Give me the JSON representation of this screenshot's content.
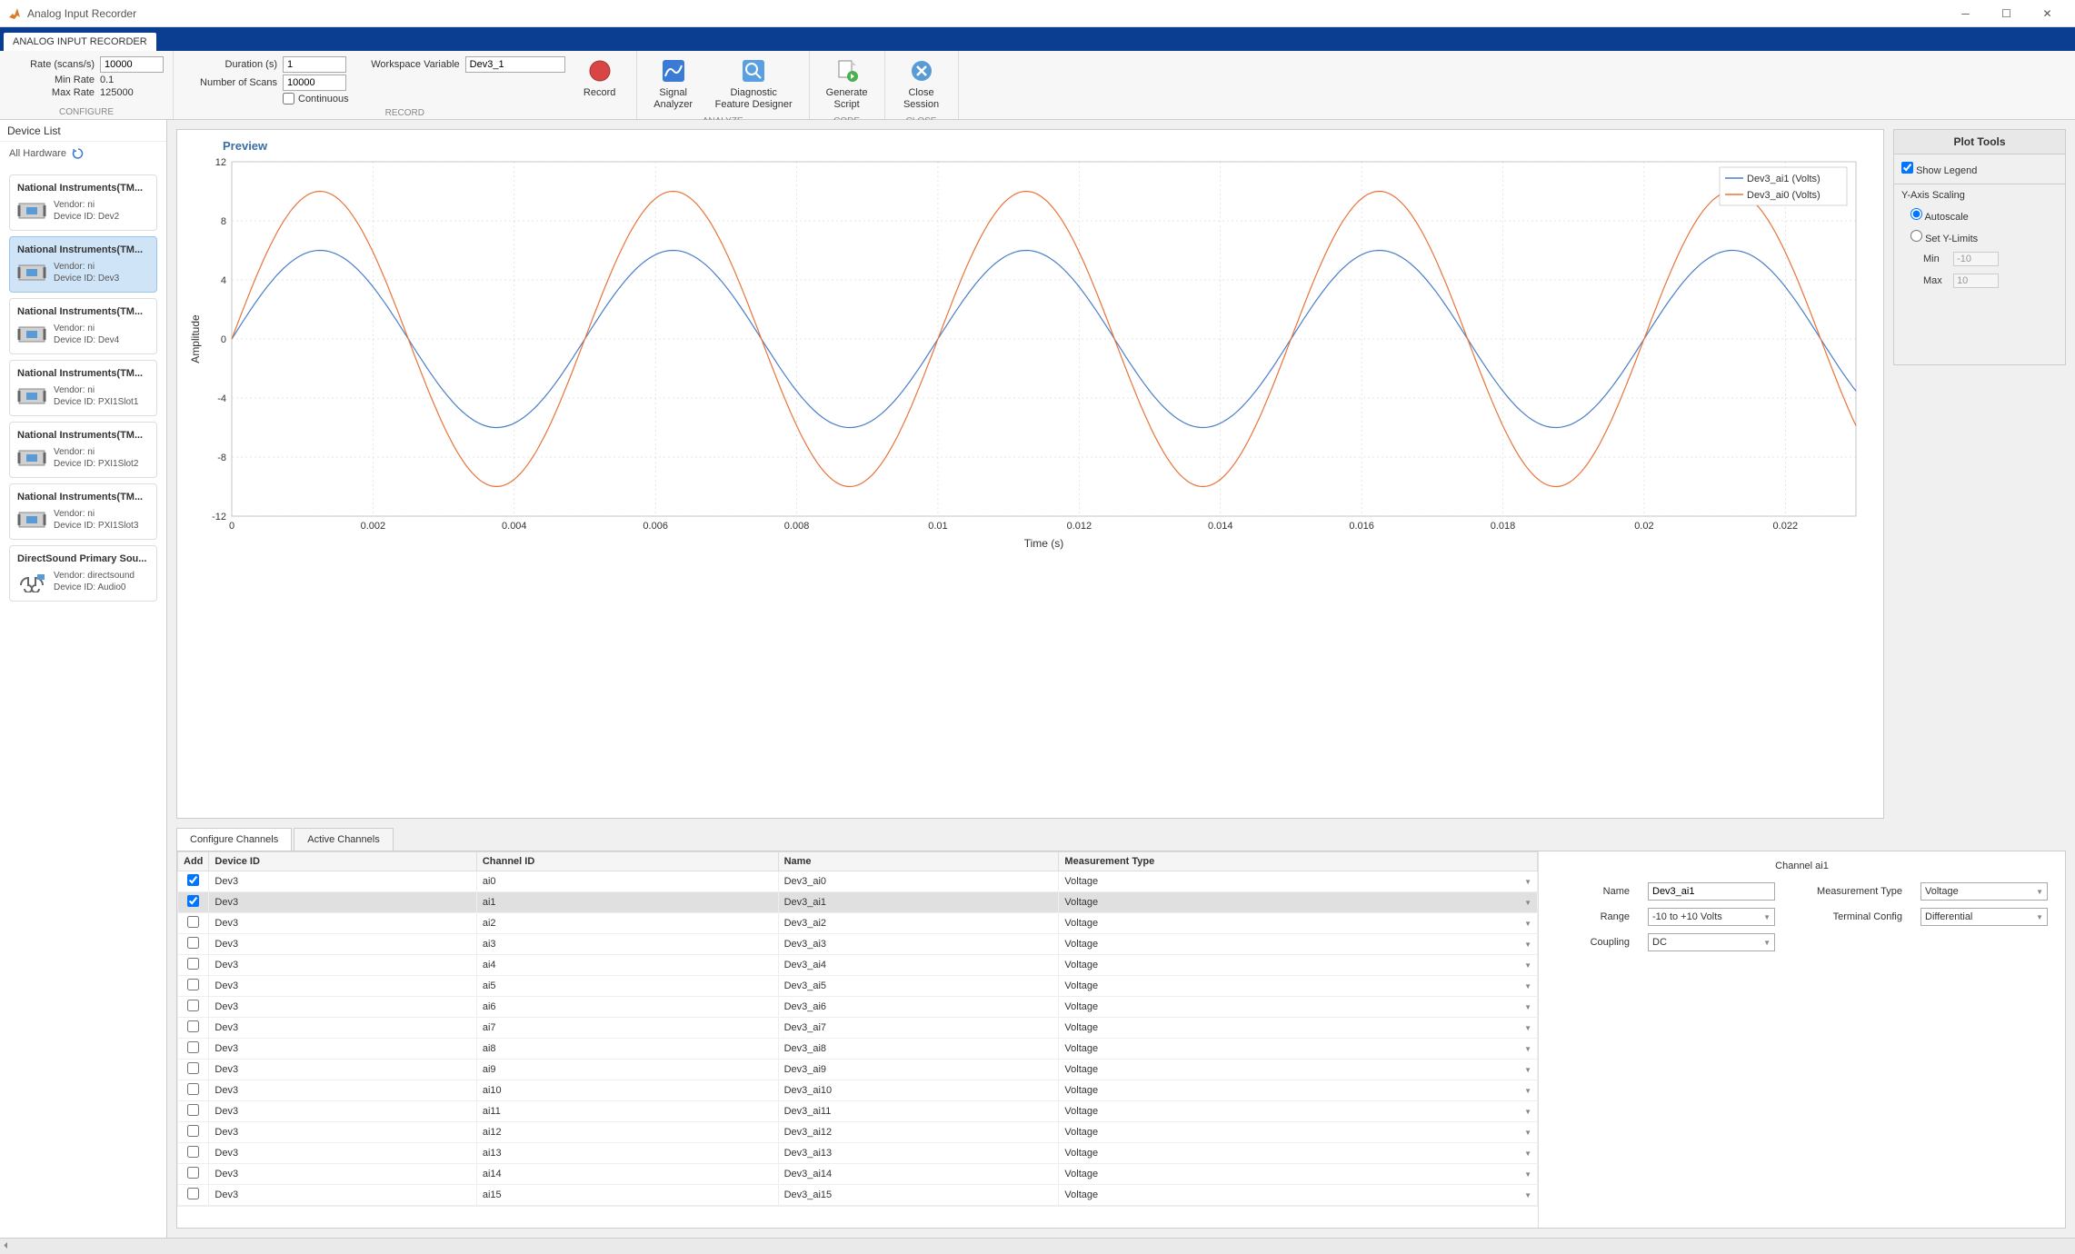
{
  "window": {
    "title": "Analog Input Recorder"
  },
  "tabstrip": {
    "main_tab": "ANALOG INPUT RECORDER"
  },
  "ribbon": {
    "configure": {
      "title": "CONFIGURE",
      "rate_label": "Rate (scans/s)",
      "rate_value": "10000",
      "min_rate_label": "Min Rate",
      "min_rate_value": "0.1",
      "max_rate_label": "Max Rate",
      "max_rate_value": "125000"
    },
    "record": {
      "title": "RECORD",
      "duration_label": "Duration (s)",
      "duration_value": "1",
      "numscans_label": "Number of Scans",
      "numscans_value": "10000",
      "continuous_label": "Continuous",
      "wsvar_label": "Workspace Variable",
      "wsvar_value": "Dev3_1",
      "record_btn": "Record"
    },
    "analyze": {
      "title": "ANALYZE",
      "signal_btn": "Signal\nAnalyzer",
      "diag_btn": "Diagnostic\nFeature Designer"
    },
    "code": {
      "title": "CODE",
      "generate_btn": "Generate\nScript"
    },
    "close": {
      "title": "CLOSE",
      "close_btn": "Close\nSession"
    }
  },
  "sidebar": {
    "header": "Device List",
    "all_hw": "All Hardware",
    "devices": [
      {
        "title": "National Instruments(TM...",
        "vendor": "Vendor: ni",
        "id": "Device ID: Dev2",
        "selected": false,
        "type": "ni"
      },
      {
        "title": "National Instruments(TM...",
        "vendor": "Vendor: ni",
        "id": "Device ID: Dev3",
        "selected": true,
        "type": "ni"
      },
      {
        "title": "National Instruments(TM...",
        "vendor": "Vendor: ni",
        "id": "Device ID: Dev4",
        "selected": false,
        "type": "ni"
      },
      {
        "title": "National Instruments(TM...",
        "vendor": "Vendor: ni",
        "id": "Device ID: PXI1Slot1",
        "selected": false,
        "type": "ni"
      },
      {
        "title": "National Instruments(TM...",
        "vendor": "Vendor: ni",
        "id": "Device ID: PXI1Slot2",
        "selected": false,
        "type": "ni"
      },
      {
        "title": "National Instruments(TM...",
        "vendor": "Vendor: ni",
        "id": "Device ID: PXI1Slot3",
        "selected": false,
        "type": "ni"
      },
      {
        "title": "DirectSound Primary Sou...",
        "vendor": "Vendor: directsound",
        "id": "Device ID: Audio0",
        "selected": false,
        "type": "audio"
      }
    ]
  },
  "preview": {
    "title": "Preview",
    "xlabel": "Time (s)",
    "ylabel": "Amplitude",
    "legend": [
      "Dev3_ai1 (Volts)",
      "Dev3_ai0 (Volts)"
    ]
  },
  "plot_tools": {
    "title": "Plot Tools",
    "show_legend": "Show Legend",
    "yaxis_scaling": "Y-Axis Scaling",
    "autoscale": "Autoscale",
    "set_ylimits": "Set Y-Limits",
    "min_label": "Min",
    "min_value": "-10",
    "max_label": "Max",
    "max_value": "10"
  },
  "tabs": {
    "configure": "Configure Channels",
    "active": "Active Channels"
  },
  "channel_table": {
    "headers": {
      "add": "Add",
      "device": "Device ID",
      "channel": "Channel ID",
      "name": "Name",
      "mtype": "Measurement Type"
    },
    "rows": [
      {
        "add": true,
        "device": "Dev3",
        "channel": "ai0",
        "name": "Dev3_ai0",
        "mtype": "Voltage",
        "sel": false
      },
      {
        "add": true,
        "device": "Dev3",
        "channel": "ai1",
        "name": "Dev3_ai1",
        "mtype": "Voltage",
        "sel": true
      },
      {
        "add": false,
        "device": "Dev3",
        "channel": "ai2",
        "name": "Dev3_ai2",
        "mtype": "Voltage",
        "sel": false
      },
      {
        "add": false,
        "device": "Dev3",
        "channel": "ai3",
        "name": "Dev3_ai3",
        "mtype": "Voltage",
        "sel": false
      },
      {
        "add": false,
        "device": "Dev3",
        "channel": "ai4",
        "name": "Dev3_ai4",
        "mtype": "Voltage",
        "sel": false
      },
      {
        "add": false,
        "device": "Dev3",
        "channel": "ai5",
        "name": "Dev3_ai5",
        "mtype": "Voltage",
        "sel": false
      },
      {
        "add": false,
        "device": "Dev3",
        "channel": "ai6",
        "name": "Dev3_ai6",
        "mtype": "Voltage",
        "sel": false
      },
      {
        "add": false,
        "device": "Dev3",
        "channel": "ai7",
        "name": "Dev3_ai7",
        "mtype": "Voltage",
        "sel": false
      },
      {
        "add": false,
        "device": "Dev3",
        "channel": "ai8",
        "name": "Dev3_ai8",
        "mtype": "Voltage",
        "sel": false
      },
      {
        "add": false,
        "device": "Dev3",
        "channel": "ai9",
        "name": "Dev3_ai9",
        "mtype": "Voltage",
        "sel": false
      },
      {
        "add": false,
        "device": "Dev3",
        "channel": "ai10",
        "name": "Dev3_ai10",
        "mtype": "Voltage",
        "sel": false
      },
      {
        "add": false,
        "device": "Dev3",
        "channel": "ai11",
        "name": "Dev3_ai11",
        "mtype": "Voltage",
        "sel": false
      },
      {
        "add": false,
        "device": "Dev3",
        "channel": "ai12",
        "name": "Dev3_ai12",
        "mtype": "Voltage",
        "sel": false
      },
      {
        "add": false,
        "device": "Dev3",
        "channel": "ai13",
        "name": "Dev3_ai13",
        "mtype": "Voltage",
        "sel": false
      },
      {
        "add": false,
        "device": "Dev3",
        "channel": "ai14",
        "name": "Dev3_ai14",
        "mtype": "Voltage",
        "sel": false
      },
      {
        "add": false,
        "device": "Dev3",
        "channel": "ai15",
        "name": "Dev3_ai15",
        "mtype": "Voltage",
        "sel": false
      }
    ]
  },
  "channel_props": {
    "title": "Channel ai1",
    "name_label": "Name",
    "name_value": "Dev3_ai1",
    "range_label": "Range",
    "range_value": "-10 to +10 Volts",
    "coupling_label": "Coupling",
    "coupling_value": "DC",
    "mtype_label": "Measurement Type",
    "mtype_value": "Voltage",
    "term_label": "Terminal Config",
    "term_value": "Differential"
  },
  "chart_data": {
    "type": "line",
    "title": "Preview",
    "xlabel": "Time (s)",
    "ylabel": "Amplitude",
    "xlim": [
      0,
      0.023
    ],
    "ylim": [
      -12,
      12
    ],
    "xticks": [
      0,
      0.002,
      0.004,
      0.006,
      0.008,
      0.01,
      0.012,
      0.014,
      0.016,
      0.018,
      0.02,
      0.022
    ],
    "yticks": [
      -12,
      -8,
      -4,
      0,
      4,
      8,
      12
    ],
    "series": [
      {
        "name": "Dev3_ai1 (Volts)",
        "color": "#4a7ec8",
        "amplitude": 6,
        "frequency": 200,
        "phase": 0
      },
      {
        "name": "Dev3_ai0 (Volts)",
        "color": "#e8743b",
        "amplitude": 10,
        "frequency": 200,
        "phase": 0
      }
    ]
  }
}
